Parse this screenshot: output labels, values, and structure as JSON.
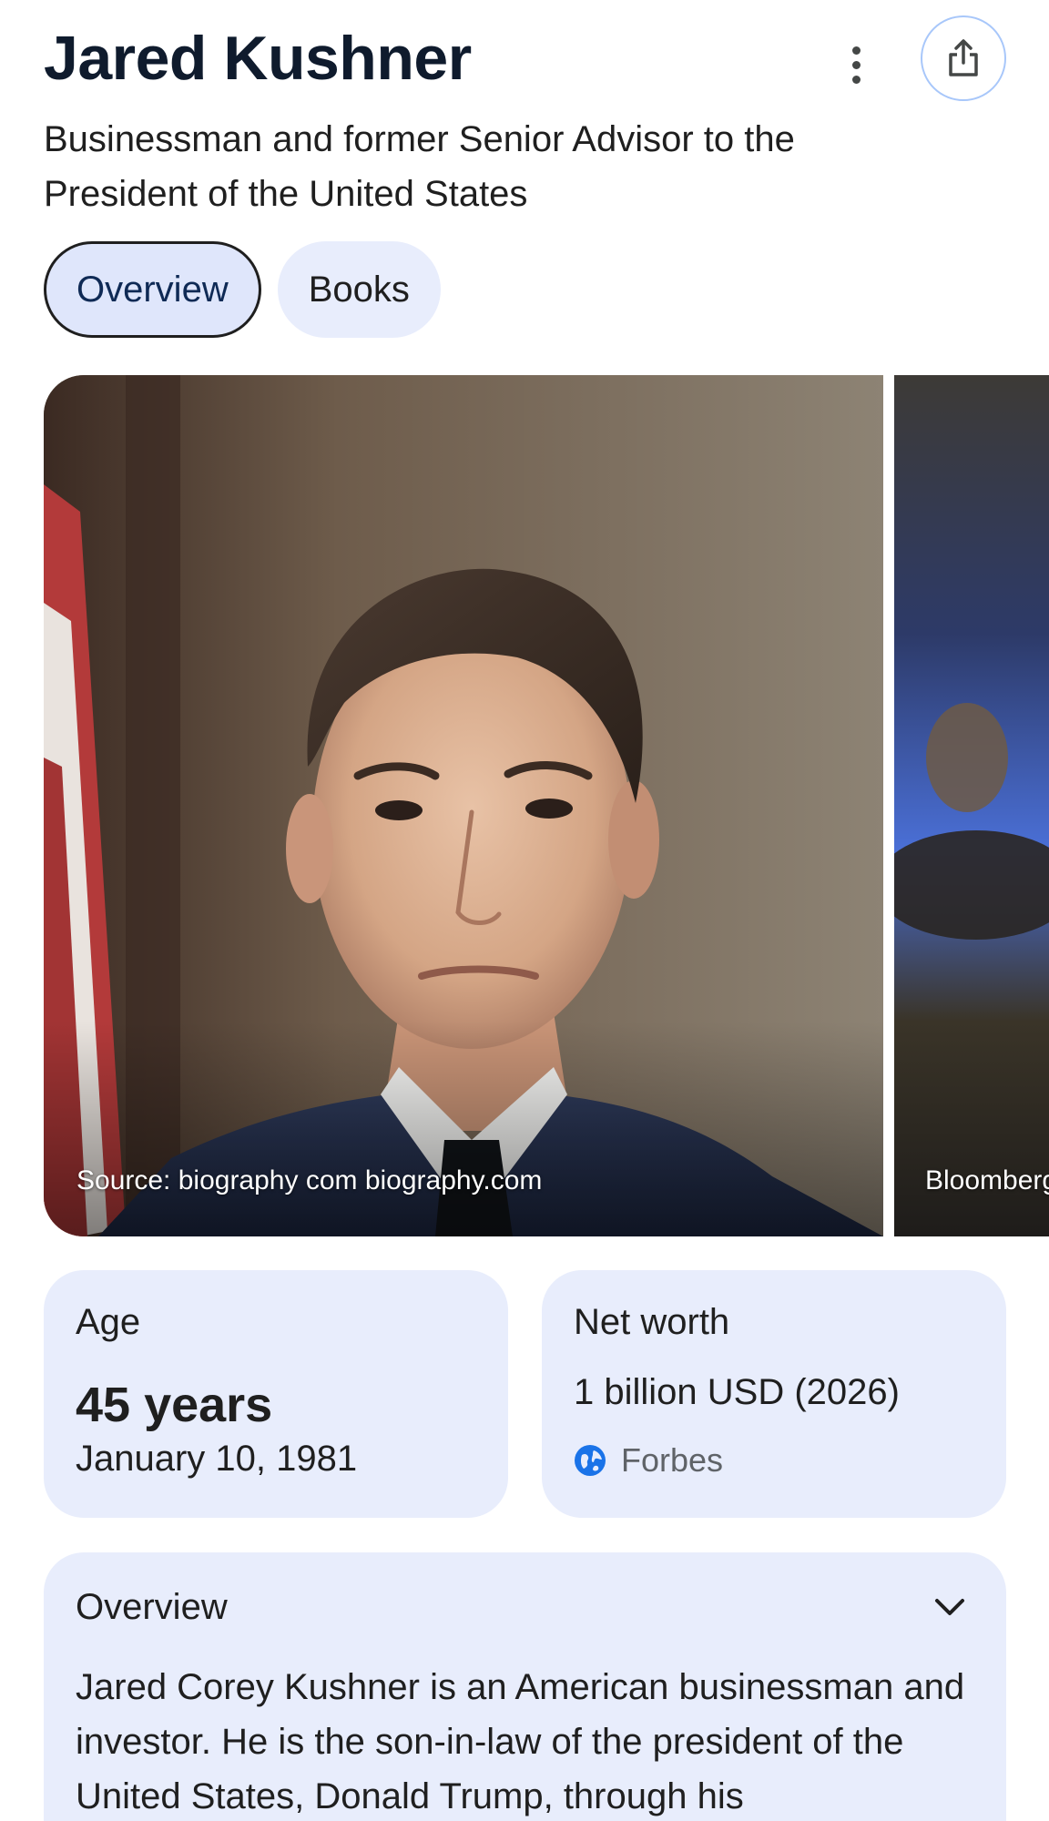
{
  "header": {
    "title": "Jared Kushner",
    "subtitle": "Businessman and former Senior Advisor to the President of the United States"
  },
  "icons": {
    "more": "more-vert-icon",
    "share": "share-icon",
    "source": "globe-icon",
    "chevron": "chevron-down-icon"
  },
  "tabs": [
    {
      "label": "Overview",
      "active": true
    },
    {
      "label": "Books",
      "active": false
    }
  ],
  "gallery": {
    "images": [
      {
        "caption": "Source: biography com biography.com"
      },
      {
        "caption": "Bloomberg"
      }
    ]
  },
  "facts": {
    "age": {
      "label": "Age",
      "value": "45 years",
      "date": "January 10, 1981"
    },
    "net_worth": {
      "label": "Net worth",
      "value": "1 billion USD (2026)",
      "source": "Forbes"
    }
  },
  "overview": {
    "title": "Overview",
    "text": "Jared Corey Kushner is an American businessman and investor. He is the son-in-law of the president of the United States, Donald Trump, through his"
  },
  "colors": {
    "card_bg": "#e8edfc",
    "share_ring": "#a8c7fa",
    "title": "#0f1b2d"
  }
}
